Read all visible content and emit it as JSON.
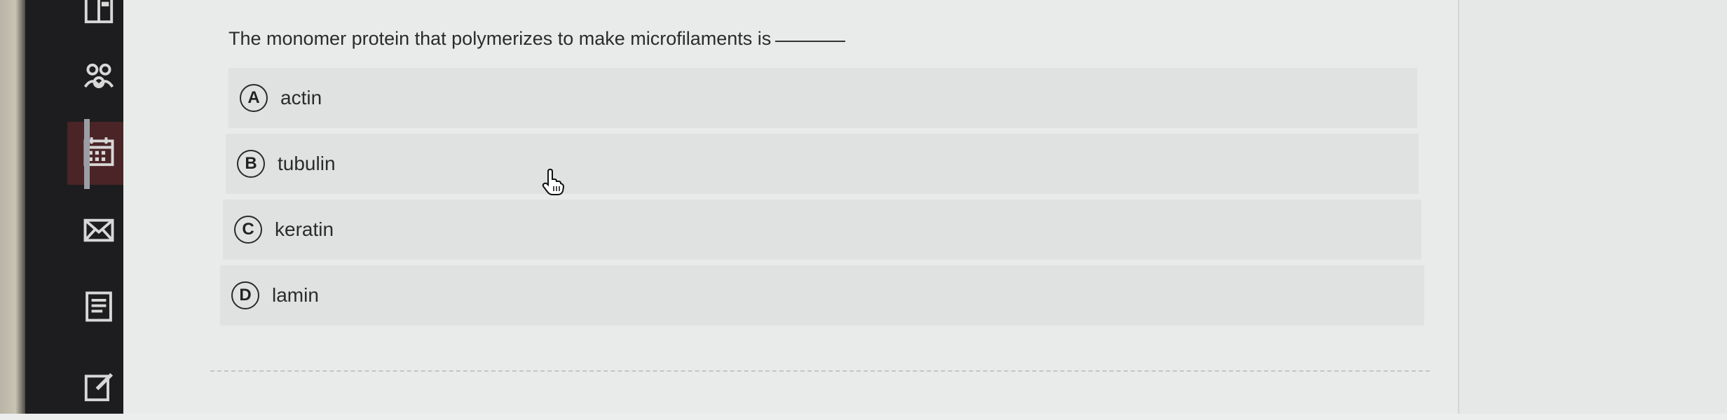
{
  "question": {
    "text": "The monomer protein that polymerizes to make microfilaments is"
  },
  "options": [
    {
      "letter": "A",
      "text": "actin"
    },
    {
      "letter": "B",
      "text": "tubulin"
    },
    {
      "letter": "C",
      "text": "keratin"
    },
    {
      "letter": "D",
      "text": "lamin"
    }
  ],
  "sidebar": {
    "items": [
      {
        "icon": "panel-icon"
      },
      {
        "icon": "people-icon"
      },
      {
        "icon": "calendar-icon",
        "active": true
      },
      {
        "icon": "mail-icon"
      },
      {
        "icon": "document-icon"
      },
      {
        "icon": "edit-icon"
      }
    ]
  },
  "colors": {
    "sidebar": "#1d1d1f",
    "active_item": "#4a2426",
    "option_background": "#e0e2e2",
    "page_background": "#e9ebeb"
  }
}
